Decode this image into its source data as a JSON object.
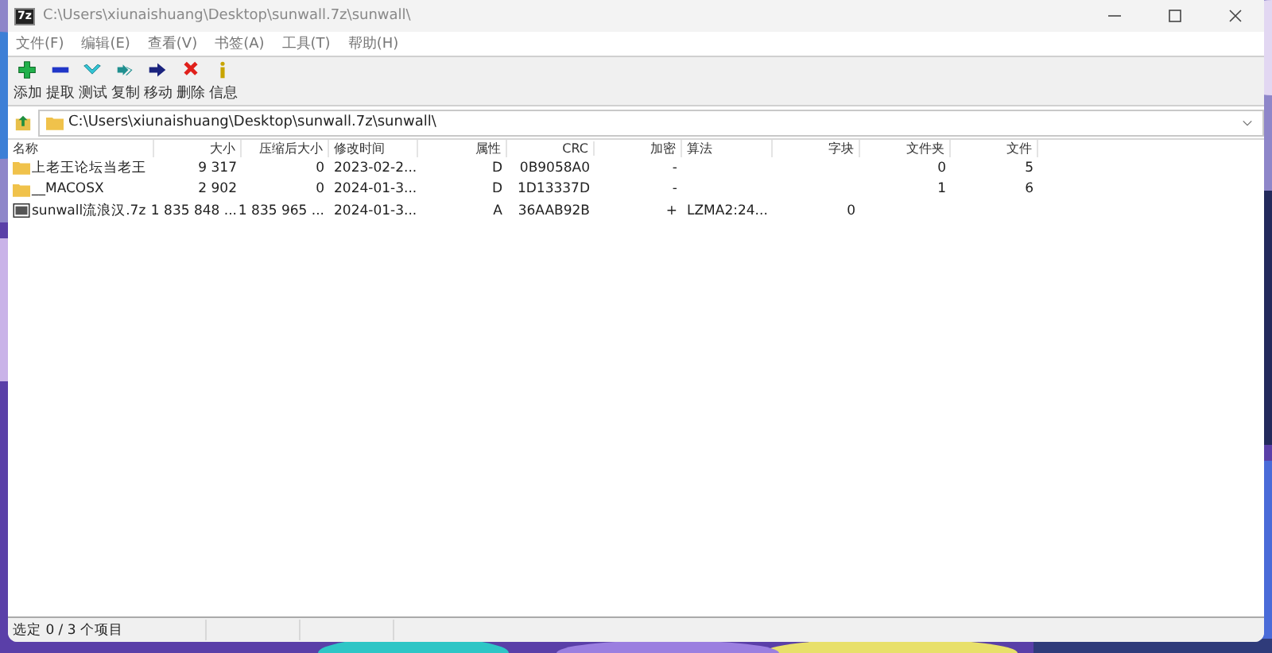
{
  "window": {
    "title": "C:\\Users\\xiunaishuang\\Desktop\\sunwall.7z\\sunwall\\",
    "app_icon": "7z"
  },
  "menu": [
    "文件(F)",
    "编辑(E)",
    "查看(V)",
    "书签(A)",
    "工具(T)",
    "帮助(H)"
  ],
  "toolbar": [
    {
      "kind": "add",
      "label": "添加"
    },
    {
      "kind": "extract",
      "label": "提取"
    },
    {
      "kind": "test",
      "label": "测试"
    },
    {
      "kind": "copy",
      "label": "复制"
    },
    {
      "kind": "move",
      "label": "移动"
    },
    {
      "kind": "delete",
      "label": "删除"
    },
    {
      "kind": "info",
      "label": "信息"
    }
  ],
  "address": {
    "path": "C:\\Users\\xiunaishuang\\Desktop\\sunwall.7z\\sunwall\\"
  },
  "table": {
    "columns": [
      "名称",
      "大小",
      "压缩后大小",
      "修改时间",
      "属性",
      "CRC",
      "加密",
      "算法",
      "字块",
      "文件夹",
      "文件"
    ],
    "rows": [
      {
        "kind": "folder",
        "name": "上老王论坛当老王",
        "size": "9 317",
        "packed": "0",
        "modified": "2023-02-2...",
        "attributes": "D",
        "crc": "0B9058A0",
        "encrypted": "-",
        "folders": "0",
        "files": "5"
      },
      {
        "kind": "folder",
        "name": "__MACOSX",
        "size": "2 902",
        "packed": "0",
        "modified": "2024-01-3...",
        "attributes": "D",
        "crc": "1D13337D",
        "encrypted": "-",
        "folders": "1",
        "files": "6"
      },
      {
        "kind": "archive",
        "name": "sunwall流浪汉.7z",
        "size": "1 835 848 ...",
        "packed": "1 835 965 ...",
        "modified": "2024-01-3...",
        "attributes": "A",
        "crc": "36AAB92B",
        "encrypted": "+",
        "method": "LZMA2:24...",
        "block": "0"
      }
    ]
  },
  "status_bar": {
    "text": "选定 0 / 3 个项目"
  }
}
